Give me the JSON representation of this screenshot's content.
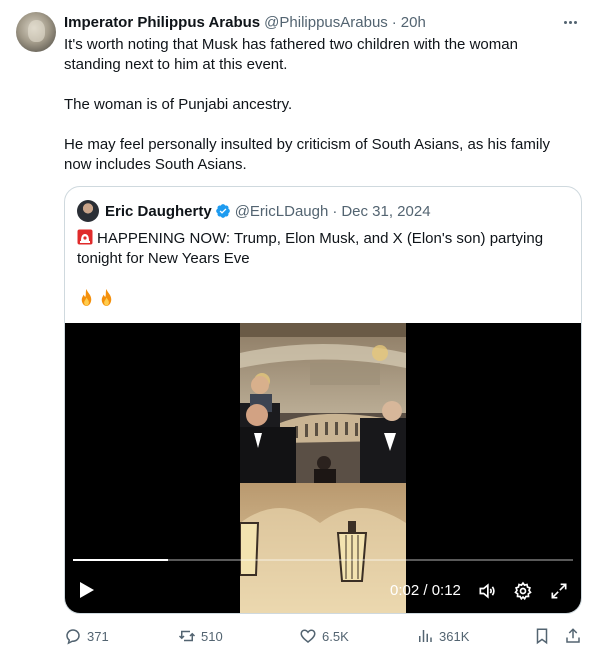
{
  "tweet": {
    "author_name": "Imperator Philippus Arabus",
    "author_handle": "@PhilippusArabus",
    "separator": "·",
    "time": "20h",
    "paragraphs": [
      "It's worth noting that Musk has fathered two children with the woman standing next to him at this event.",
      "The woman is of Punjabi ancestry.",
      "He may feel personally insulted by criticism of South Asians, as his family now includes South Asians."
    ]
  },
  "quoted_tweet": {
    "author_name": "Eric Daugherty",
    "verified": true,
    "author_handle": "@EricLDaugh",
    "separator": "·",
    "date": "Dec 31, 2024",
    "text": "HAPPENING NOW: Trump, Elon Musk, and X (Elon's son) partying tonight for New Years Eve",
    "emoji": [
      "fire",
      "fire"
    ],
    "video": {
      "current_time": "0:02",
      "duration": "0:12",
      "time_display": "0:02 / 0:12",
      "progress_fraction": 0.19
    }
  },
  "actions": {
    "replies": "371",
    "reposts": "510",
    "likes": "6.5K",
    "views": "361K"
  },
  "colors": {
    "text": "#0f1419",
    "muted": "#536471",
    "border": "#cfd9de",
    "verified": "#1d9bf0"
  }
}
